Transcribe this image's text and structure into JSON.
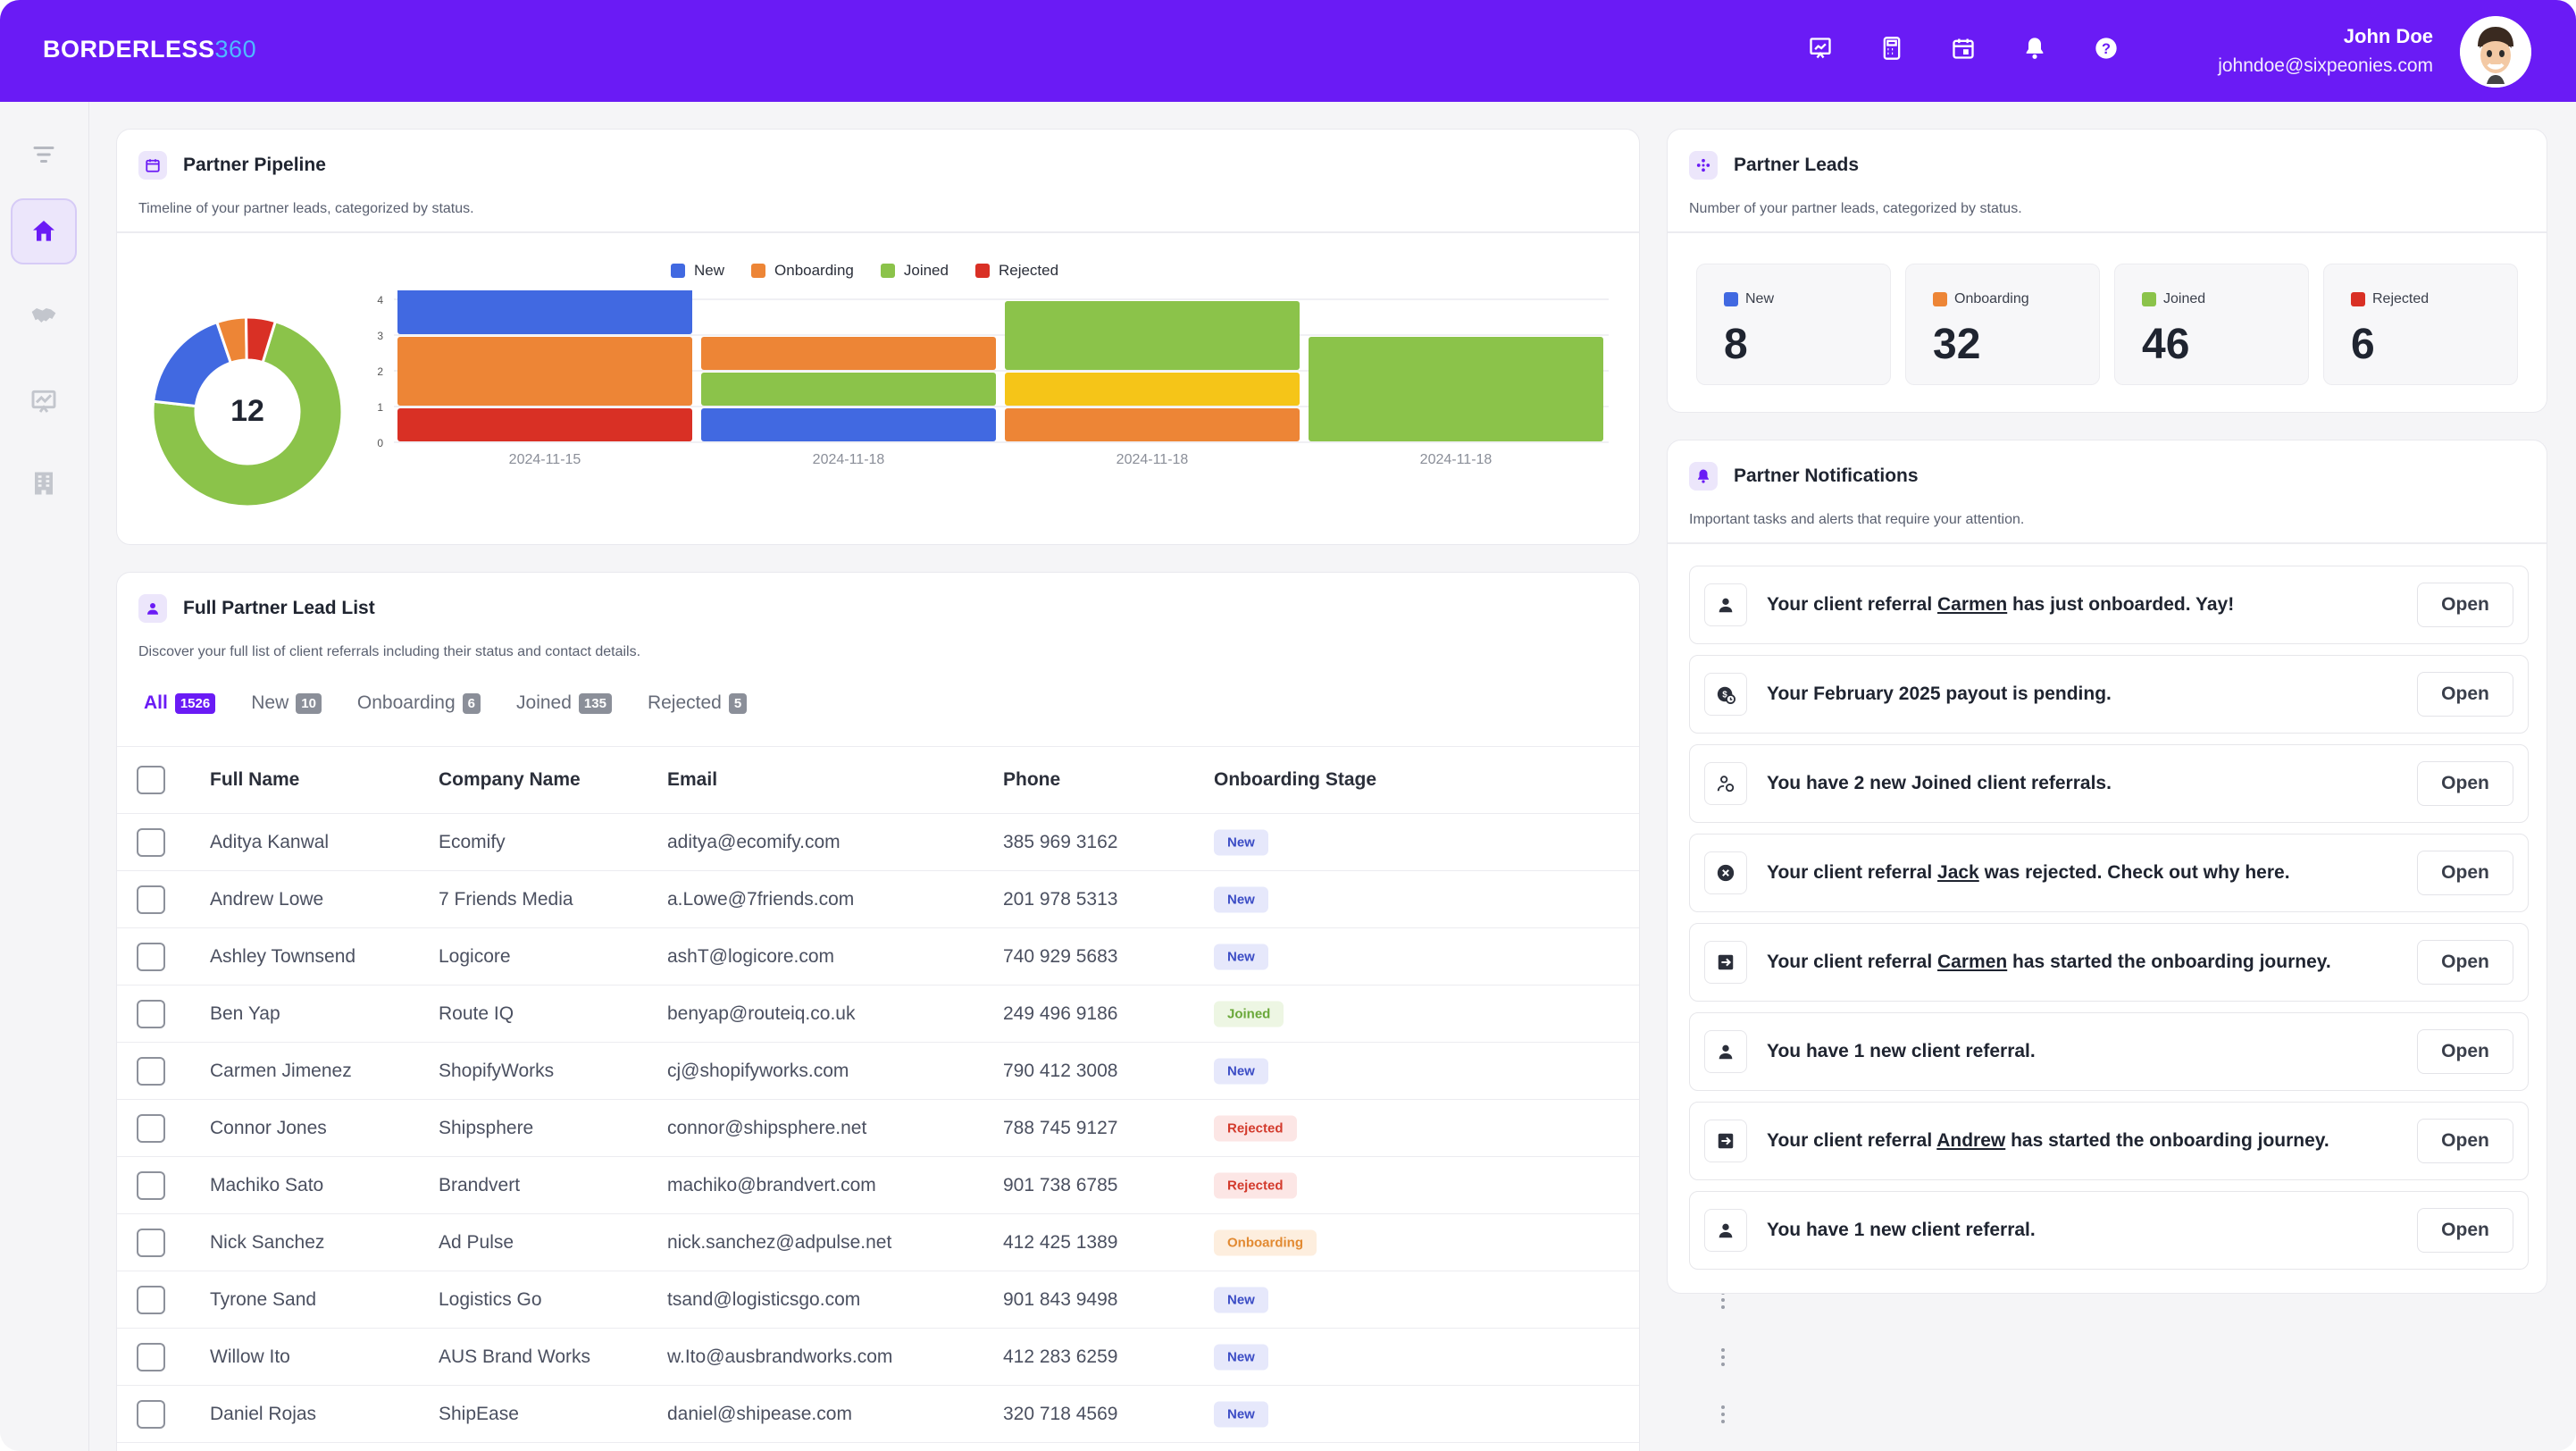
{
  "header": {
    "brand_main": "BORDERLESS",
    "brand_num": "360",
    "user_name": "John Doe",
    "user_email": "johndoe@sixpeonies.com",
    "icons": [
      "presentation-chart-icon",
      "calculator-icon",
      "calendar-icon",
      "bell-icon",
      "help-icon"
    ]
  },
  "sidebar": {
    "items": [
      "filter-icon",
      "home-icon",
      "handshake-icon",
      "chart-icon",
      "building-icon"
    ],
    "active": "home-icon"
  },
  "colors": {
    "accent": "#6a1bf5",
    "new": "#4169e1",
    "onboarding": "#ed8536",
    "joined": "#8bc34a",
    "rejected": "#d93025",
    "pending": "#f5c518"
  },
  "pipeline": {
    "title": "Partner Pipeline",
    "subtitle": "Timeline of your partner leads, categorized by status.",
    "donut_total": "12",
    "legend": [
      "New",
      "Onboarding",
      "Joined",
      "Rejected"
    ]
  },
  "chart_data": {
    "type": "bar",
    "stacked": true,
    "categories": [
      "2024-11-15",
      "2024-11-18",
      "2024-11-18",
      "2024-11-18"
    ],
    "ylim": [
      0,
      5
    ],
    "yticks": [
      "0",
      "1",
      "2",
      "3",
      "4",
      "5"
    ],
    "segments": [
      [
        {
          "status": "Rejected",
          "value": 1
        },
        {
          "status": "Onboarding",
          "value": 2
        },
        {
          "status": "New",
          "value": 2
        }
      ],
      [
        {
          "status": "New",
          "value": 1
        },
        {
          "status": "Joined",
          "value": 1
        },
        {
          "status": "Onboarding",
          "value": 1
        }
      ],
      [
        {
          "status": "Onboarding",
          "value": 1
        },
        {
          "status": "Pending",
          "value": 1
        },
        {
          "status": "Joined",
          "value": 2
        }
      ],
      [
        {
          "status": "Joined",
          "value": 3
        }
      ]
    ],
    "donut": [
      {
        "status": "Joined",
        "value": 0.72
      },
      {
        "status": "New",
        "value": 0.18
      },
      {
        "status": "Onboarding",
        "value": 0.05
      },
      {
        "status": "Rejected",
        "value": 0.05
      }
    ],
    "legend_position": "top"
  },
  "leadlist": {
    "title": "Full Partner Lead List",
    "subtitle": "Discover your full list of client referrals including their status and contact details.",
    "tabs": [
      {
        "label": "All",
        "count": "1526"
      },
      {
        "label": "New",
        "count": "10"
      },
      {
        "label": "Onboarding",
        "count": "6"
      },
      {
        "label": "Joined",
        "count": "135"
      },
      {
        "label": "Rejected",
        "count": "5"
      }
    ],
    "columns": [
      "Full Name",
      "Company Name",
      "Email",
      "Phone",
      "Onboarding Stage"
    ],
    "rows": [
      {
        "name": "Aditya Kanwal",
        "company": "Ecomify",
        "email": "aditya@ecomify.com",
        "phone": "385 969 3162",
        "stage": "New"
      },
      {
        "name": "Andrew Lowe",
        "company": "7 Friends Media",
        "email": "a.Lowe@7friends.com",
        "phone": "201 978 5313",
        "stage": "New"
      },
      {
        "name": "Ashley Townsend",
        "company": "Logicore",
        "email": "ashT@logicore.com",
        "phone": "740 929 5683",
        "stage": "New"
      },
      {
        "name": "Ben Yap",
        "company": "Route IQ",
        "email": "benyap@routeiq.co.uk",
        "phone": "249 496 9186",
        "stage": "Joined"
      },
      {
        "name": "Carmen Jimenez",
        "company": "ShopifyWorks",
        "email": "cj@shopifyworks.com",
        "phone": "790 412 3008",
        "stage": "New"
      },
      {
        "name": "Connor Jones",
        "company": "Shipsphere",
        "email": "connor@shipsphere.net",
        "phone": "788 745 9127",
        "stage": "Rejected"
      },
      {
        "name": "Machiko Sato",
        "company": "Brandvert",
        "email": "machiko@brandvert.com",
        "phone": "901 738 6785",
        "stage": "Rejected"
      },
      {
        "name": "Nick Sanchez",
        "company": "Ad Pulse",
        "email": "nick.sanchez@adpulse.net",
        "phone": "412 425 1389",
        "stage": "Onboarding"
      },
      {
        "name": "Tyrone Sand",
        "company": "Logistics Go",
        "email": "tsand@logisticsgo.com",
        "phone": "901 843 9498",
        "stage": "New"
      },
      {
        "name": "Willow Ito",
        "company": "AUS Brand Works",
        "email": "w.Ito@ausbrandworks.com",
        "phone": "412 283 6259",
        "stage": "New"
      },
      {
        "name": "Daniel Rojas",
        "company": "ShipEase",
        "email": "daniel@shipease.com",
        "phone": "320 718 4569",
        "stage": "New"
      }
    ]
  },
  "leads": {
    "title": "Partner Leads",
    "subtitle": "Number of your partner leads, categorized by status.",
    "stats": [
      {
        "label": "New",
        "value": "8"
      },
      {
        "label": "Onboarding",
        "value": "32"
      },
      {
        "label": "Joined",
        "value": "46"
      },
      {
        "label": "Rejected",
        "value": "6"
      }
    ]
  },
  "notifications": {
    "title": "Partner Notifications",
    "subtitle": "Important tasks and alerts that require your attention.",
    "open_label": "Open",
    "items": [
      {
        "icon": "person-icon",
        "pre": "Your client referral ",
        "link": "Carmen",
        "post": " has just onboarded. Yay!"
      },
      {
        "icon": "payout-clock-icon",
        "pre": "Your February 2025 payout is pending.",
        "link": "",
        "post": ""
      },
      {
        "icon": "people-icon",
        "pre": "You have 2 new Joined client referrals.",
        "link": "",
        "post": ""
      },
      {
        "icon": "x-circle-icon",
        "pre": "Your client referral ",
        "link": "Jack",
        "post": " was rejected. Check out why here."
      },
      {
        "icon": "arrow-enter-icon",
        "pre": "Your client referral ",
        "link": "Carmen",
        "post": " has started the onboarding journey."
      },
      {
        "icon": "person-icon",
        "pre": "You have 1 new client referral.",
        "link": "",
        "post": ""
      },
      {
        "icon": "arrow-enter-icon",
        "pre": "Your client referral ",
        "link": "Andrew",
        "post": " has started the onboarding journey."
      },
      {
        "icon": "person-icon",
        "pre": "You have 1 new client referral.",
        "link": "",
        "post": ""
      }
    ]
  }
}
